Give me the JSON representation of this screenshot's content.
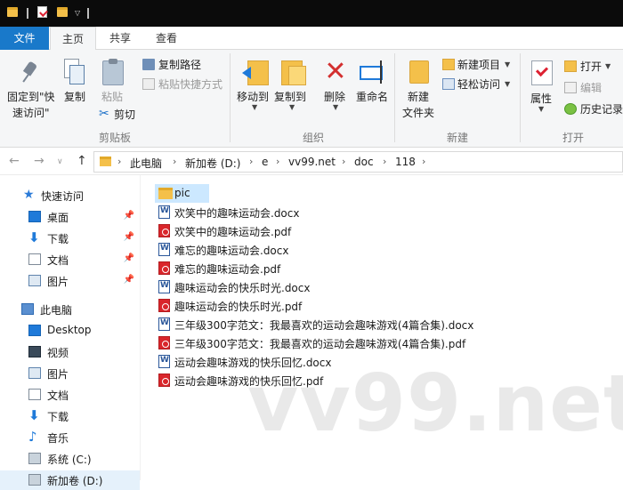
{
  "menu_tabs": {
    "file": "文件",
    "home": "主页",
    "share": "共享",
    "view": "查看"
  },
  "ribbon": {
    "clipboard": {
      "pin_label_1": "固定到\"快",
      "pin_label_2": "速访问\"",
      "copy": "复制",
      "paste": "粘贴",
      "copy_path": "复制路径",
      "paste_shortcut": "粘贴快捷方式",
      "cut": "剪切",
      "group": "剪贴板"
    },
    "organize": {
      "move_to": "移动到",
      "copy_to": "复制到",
      "delete": "删除",
      "rename": "重命名",
      "group": "组织"
    },
    "new": {
      "new_folder_1": "新建",
      "new_folder_2": "文件夹",
      "new_item": "新建项目",
      "easy_access": "轻松访问",
      "group": "新建"
    },
    "open": {
      "properties": "属性",
      "open": "打开",
      "edit": "编辑",
      "history": "历史记录",
      "group": "打开"
    }
  },
  "address": {
    "crumbs": [
      "此电脑",
      "新加卷 (D:)",
      "e",
      "vv99.net",
      "doc",
      "118"
    ]
  },
  "sidebar": {
    "quick_access": "快速访问",
    "quick_items": [
      "桌面",
      "下载",
      "文档",
      "图片"
    ],
    "this_pc": "此电脑",
    "pc_items": [
      "Desktop",
      "视频",
      "图片",
      "文档",
      "下载",
      "音乐",
      "系统 (C:)",
      "新加卷 (D:)"
    ]
  },
  "files": [
    {
      "name": "pic",
      "type": "folder"
    },
    {
      "name": "欢笑中的趣味运动会.docx",
      "type": "docx"
    },
    {
      "name": "欢笑中的趣味运动会.pdf",
      "type": "pdf"
    },
    {
      "name": "难忘的趣味运动会.docx",
      "type": "docx"
    },
    {
      "name": "难忘的趣味运动会.pdf",
      "type": "pdf"
    },
    {
      "name": "趣味运动会的快乐时光.docx",
      "type": "docx"
    },
    {
      "name": "趣味运动会的快乐时光.pdf",
      "type": "pdf"
    },
    {
      "name": "三年级300字范文：我最喜欢的运动会趣味游戏(4篇合集).docx",
      "type": "docx"
    },
    {
      "name": "三年级300字范文：我最喜欢的运动会趣味游戏(4篇合集).pdf",
      "type": "pdf"
    },
    {
      "name": "运动会趣味游戏的快乐回忆.docx",
      "type": "docx"
    },
    {
      "name": "运动会趣味游戏的快乐回忆.pdf",
      "type": "pdf"
    }
  ],
  "watermark": "vv99.net"
}
